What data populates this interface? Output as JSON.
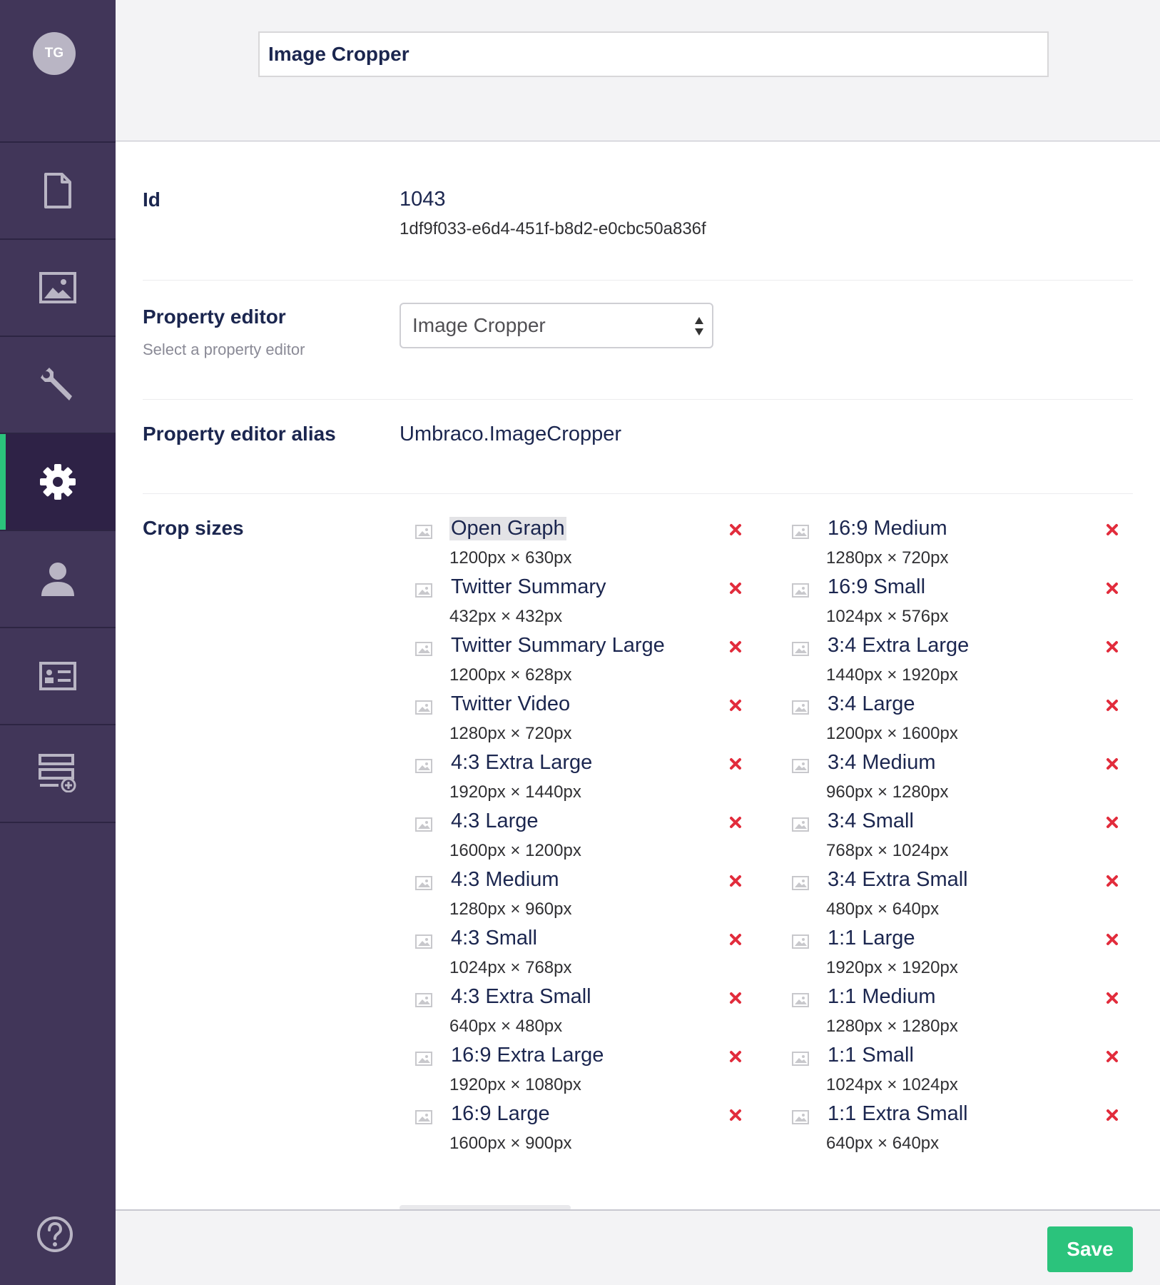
{
  "user": {
    "initials": "TG"
  },
  "sidebar": {
    "sections": [
      {
        "name": "content",
        "icon": "document-icon"
      },
      {
        "name": "media",
        "icon": "image-icon"
      },
      {
        "name": "settings",
        "icon": "wrench-icon"
      },
      {
        "name": "developer",
        "icon": "gear-icon",
        "active": true
      },
      {
        "name": "users",
        "icon": "user-icon"
      },
      {
        "name": "members",
        "icon": "id-card-icon"
      },
      {
        "name": "forms",
        "icon": "form-add-icon"
      }
    ],
    "help_icon": "help-icon"
  },
  "header": {
    "name": "Image Cropper"
  },
  "fields": {
    "id": {
      "label": "Id",
      "value": "1043",
      "guid": "1df9f033-e6d4-451f-b8d2-e0cbc50a836f"
    },
    "property_editor": {
      "label": "Property editor",
      "description": "Select a property editor",
      "selected": "Image Cropper"
    },
    "alias": {
      "label": "Property editor alias",
      "value": "Umbraco.ImageCropper"
    },
    "crop_sizes": {
      "label": "Crop sizes"
    }
  },
  "crops_left": [
    {
      "name": "Open Graph",
      "dims": "1200px × 630px"
    },
    {
      "name": "Twitter Summary",
      "dims": "432px × 432px"
    },
    {
      "name": "Twitter Summary Large",
      "dims": "1200px × 628px"
    },
    {
      "name": "Twitter Video",
      "dims": "1280px × 720px"
    },
    {
      "name": "4:3 Extra Large",
      "dims": "1920px × 1440px"
    },
    {
      "name": "4:3 Large",
      "dims": "1600px × 1200px"
    },
    {
      "name": "4:3 Medium",
      "dims": "1280px × 960px"
    },
    {
      "name": "4:3 Small",
      "dims": "1024px × 768px"
    },
    {
      "name": "4:3 Extra Small",
      "dims": "640px × 480px"
    },
    {
      "name": "16:9 Extra Large",
      "dims": "1920px × 1080px"
    },
    {
      "name": "16:9 Large",
      "dims": "1600px × 900px"
    }
  ],
  "crops_right": [
    {
      "name": "16:9 Medium",
      "dims": "1280px × 720px"
    },
    {
      "name": "16:9 Small",
      "dims": "1024px × 576px"
    },
    {
      "name": "3:4 Extra Large",
      "dims": "1440px × 1920px"
    },
    {
      "name": "3:4 Large",
      "dims": "1200px × 1600px"
    },
    {
      "name": "3:4 Medium",
      "dims": "960px × 1280px"
    },
    {
      "name": "3:4 Small",
      "dims": "768px × 1024px"
    },
    {
      "name": "3:4 Extra Small",
      "dims": "480px × 640px"
    },
    {
      "name": "1:1 Large",
      "dims": "1920px × 1920px"
    },
    {
      "name": "1:1 Medium",
      "dims": "1280px × 1280px"
    },
    {
      "name": "1:1 Small",
      "dims": "1024px × 1024px"
    },
    {
      "name": "1:1 Extra Small",
      "dims": "640px × 640px"
    }
  ],
  "footer": {
    "save_label": "Save"
  },
  "colors": {
    "sidebar": "#413659",
    "active_indicator": "#2bc37c",
    "delete": "#e22c3c",
    "save": "#2bc37c"
  }
}
